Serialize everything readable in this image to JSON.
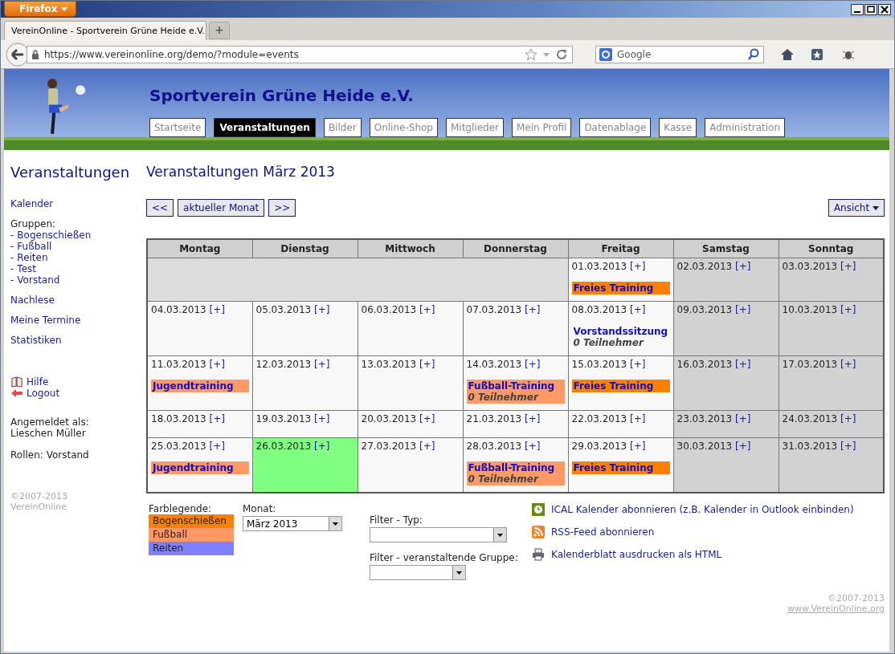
{
  "browser": {
    "menu_button": "Firefox",
    "tab_title": "VereinOnline - Sportverein Grüne Heide e.V.",
    "new_tab": "+",
    "url": "https://www.vereinonline.org/demo/?module=events",
    "search_placeholder": "Google"
  },
  "site": {
    "title": "Sportverein Grüne Heide e.V.",
    "nav": [
      {
        "label": "Startseite",
        "selected": false
      },
      {
        "label": "Veranstaltungen",
        "selected": true
      },
      {
        "label": "Bilder",
        "selected": false
      },
      {
        "label": "Online-Shop",
        "selected": false
      },
      {
        "label": "Mitglieder",
        "selected": false
      },
      {
        "label": "Mein Profil",
        "selected": false
      },
      {
        "label": "Datenablage",
        "selected": false
      },
      {
        "label": "Kasse",
        "selected": false
      },
      {
        "label": "Administration",
        "selected": false
      }
    ]
  },
  "sidebar": {
    "title": "Veranstaltungen",
    "calendar_link": "Kalender",
    "groups_label": "Gruppen:",
    "groups": [
      {
        "prefix": "-",
        "label": "Bogenschießen"
      },
      {
        "prefix": "-",
        "label": "Fußball"
      },
      {
        "prefix": "-",
        "label": "Reiten"
      },
      {
        "prefix": "-",
        "label": "Test"
      },
      {
        "prefix": "-",
        "label": "Vorstand"
      }
    ],
    "links": [
      "Nachlese",
      "Meine Termine",
      "Statistiken"
    ],
    "help": "Hilfe",
    "logout": "Logout",
    "logged_in_label": "Angemeldet als:",
    "user": "Lieschen Müller",
    "roles": "Rollen: Vorstand",
    "copyright": "©2007-2013",
    "brand": "VereinOnline"
  },
  "main": {
    "heading": "Veranstaltungen März 2013",
    "prev": "<<",
    "current": "aktueller Monat",
    "next": ">>",
    "view_button": "Ansicht",
    "weekdays": [
      "Montag",
      "Dienstag",
      "Mittwoch",
      "Donnerstag",
      "Freitag",
      "Samstag",
      "Sonntag"
    ],
    "weeks": [
      {
        "days": [
          {
            "kind": "empty"
          },
          {
            "kind": "empty"
          },
          {
            "kind": "empty"
          },
          {
            "kind": "empty"
          },
          {
            "kind": "day",
            "date": "01.03.2013",
            "add": "[+]",
            "weekend": false,
            "today": false,
            "events": [
              {
                "title": "Freies Training",
                "color": "#ff8000"
              }
            ]
          },
          {
            "kind": "day",
            "date": "02.03.2013",
            "add": "[+]",
            "weekend": true,
            "today": false
          },
          {
            "kind": "day",
            "date": "03.03.2013",
            "add": "[+]",
            "weekend": true,
            "today": false
          }
        ]
      },
      {
        "days": [
          {
            "kind": "day",
            "date": "04.03.2013",
            "add": "[+]",
            "weekend": false,
            "today": false
          },
          {
            "kind": "day",
            "date": "05.03.2013",
            "add": "[+]",
            "weekend": false,
            "today": false
          },
          {
            "kind": "day",
            "date": "06.03.2013",
            "add": "[+]",
            "weekend": false,
            "today": false
          },
          {
            "kind": "day",
            "date": "07.03.2013",
            "add": "[+]",
            "weekend": false,
            "today": false
          },
          {
            "kind": "day",
            "date": "08.03.2013",
            "add": "[+]",
            "weekend": false,
            "today": false,
            "events": [
              {
                "title": "Vorstandssitzung",
                "participants": "0 Teilnehmer"
              }
            ]
          },
          {
            "kind": "day",
            "date": "09.03.2013",
            "add": "[+]",
            "weekend": true,
            "today": false
          },
          {
            "kind": "day",
            "date": "10.03.2013",
            "add": "[+]",
            "weekend": true,
            "today": false
          }
        ]
      },
      {
        "days": [
          {
            "kind": "day",
            "date": "11.03.2013",
            "add": "[+]",
            "weekend": false,
            "today": false,
            "events": [
              {
                "title": "Jugendtraining",
                "color": "#ff9966"
              }
            ]
          },
          {
            "kind": "day",
            "date": "12.03.2013",
            "add": "[+]",
            "weekend": false,
            "today": false
          },
          {
            "kind": "day",
            "date": "13.03.2013",
            "add": "[+]",
            "weekend": false,
            "today": false
          },
          {
            "kind": "day",
            "date": "14.03.2013",
            "add": "[+]",
            "weekend": false,
            "today": false,
            "events": [
              {
                "title": "Fußball-Training",
                "color": "#ff9966",
                "participants": "0 Teilnehmer"
              }
            ]
          },
          {
            "kind": "day",
            "date": "15.03.2013",
            "add": "[+]",
            "weekend": false,
            "today": false,
            "events": [
              {
                "title": "Freies Training",
                "color": "#ff8000"
              }
            ]
          },
          {
            "kind": "day",
            "date": "16.03.2013",
            "add": "[+]",
            "weekend": true,
            "today": false
          },
          {
            "kind": "day",
            "date": "17.03.2013",
            "add": "[+]",
            "weekend": true,
            "today": false
          }
        ]
      },
      {
        "days": [
          {
            "kind": "day",
            "date": "18.03.2013",
            "add": "[+]",
            "weekend": false,
            "today": false
          },
          {
            "kind": "day",
            "date": "19.03.2013",
            "add": "[+]",
            "weekend": false,
            "today": false
          },
          {
            "kind": "day",
            "date": "20.03.2013",
            "add": "[+]",
            "weekend": false,
            "today": false
          },
          {
            "kind": "day",
            "date": "21.03.2013",
            "add": "[+]",
            "weekend": false,
            "today": false
          },
          {
            "kind": "day",
            "date": "22.03.2013",
            "add": "[+]",
            "weekend": false,
            "today": false
          },
          {
            "kind": "day",
            "date": "23.03.2013",
            "add": "[+]",
            "weekend": true,
            "today": false
          },
          {
            "kind": "day",
            "date": "24.03.2013",
            "add": "[+]",
            "weekend": true,
            "today": false
          }
        ]
      },
      {
        "days": [
          {
            "kind": "day",
            "date": "25.03.2013",
            "add": "[+]",
            "weekend": false,
            "today": false,
            "events": [
              {
                "title": "Jugendtraining",
                "color": "#ff9966"
              }
            ]
          },
          {
            "kind": "day",
            "date": "26.03.2013",
            "add": "[+]",
            "weekend": false,
            "today": true
          },
          {
            "kind": "day",
            "date": "27.03.2013",
            "add": "[+]",
            "weekend": false,
            "today": false
          },
          {
            "kind": "day",
            "date": "28.03.2013",
            "add": "[+]",
            "weekend": false,
            "today": false,
            "events": [
              {
                "title": "Fußball-Training",
                "color": "#ff9966",
                "participants": "0 Teilnehmer"
              }
            ]
          },
          {
            "kind": "day",
            "date": "29.03.2013",
            "add": "[+]",
            "weekend": false,
            "today": false,
            "events": [
              {
                "title": "Freies Training",
                "color": "#ff8000"
              }
            ]
          },
          {
            "kind": "day",
            "date": "30.03.2013",
            "add": "[+]",
            "weekend": true,
            "today": false
          },
          {
            "kind": "day",
            "date": "31.03.2013",
            "add": "[+]",
            "weekend": true,
            "today": false
          }
        ]
      }
    ]
  },
  "legend": {
    "label": "Farblegende:",
    "items": [
      {
        "label": "Bogenschießen",
        "color": "#ff8000"
      },
      {
        "label": "Fußball",
        "color": "#ff9966"
      },
      {
        "label": "Reiten",
        "color": "#8080ff"
      }
    ]
  },
  "filters": {
    "month_label": "Monat:",
    "month_value": "März 2013",
    "type_label": "Filter - Typ:",
    "group_label": "Filter - veranstaltende Gruppe:"
  },
  "links": [
    {
      "kind": "ical",
      "label": "ICAL Kalender abonnieren (z.B. Kalender in Outlook einbinden)"
    },
    {
      "kind": "rss",
      "label": "RSS-Feed abonnieren"
    },
    {
      "kind": "print",
      "label": "Kalenderblatt ausdrucken als HTML"
    }
  ],
  "footer": {
    "copyright": "©2007-2013",
    "site": "www.VereinOnline.org"
  }
}
